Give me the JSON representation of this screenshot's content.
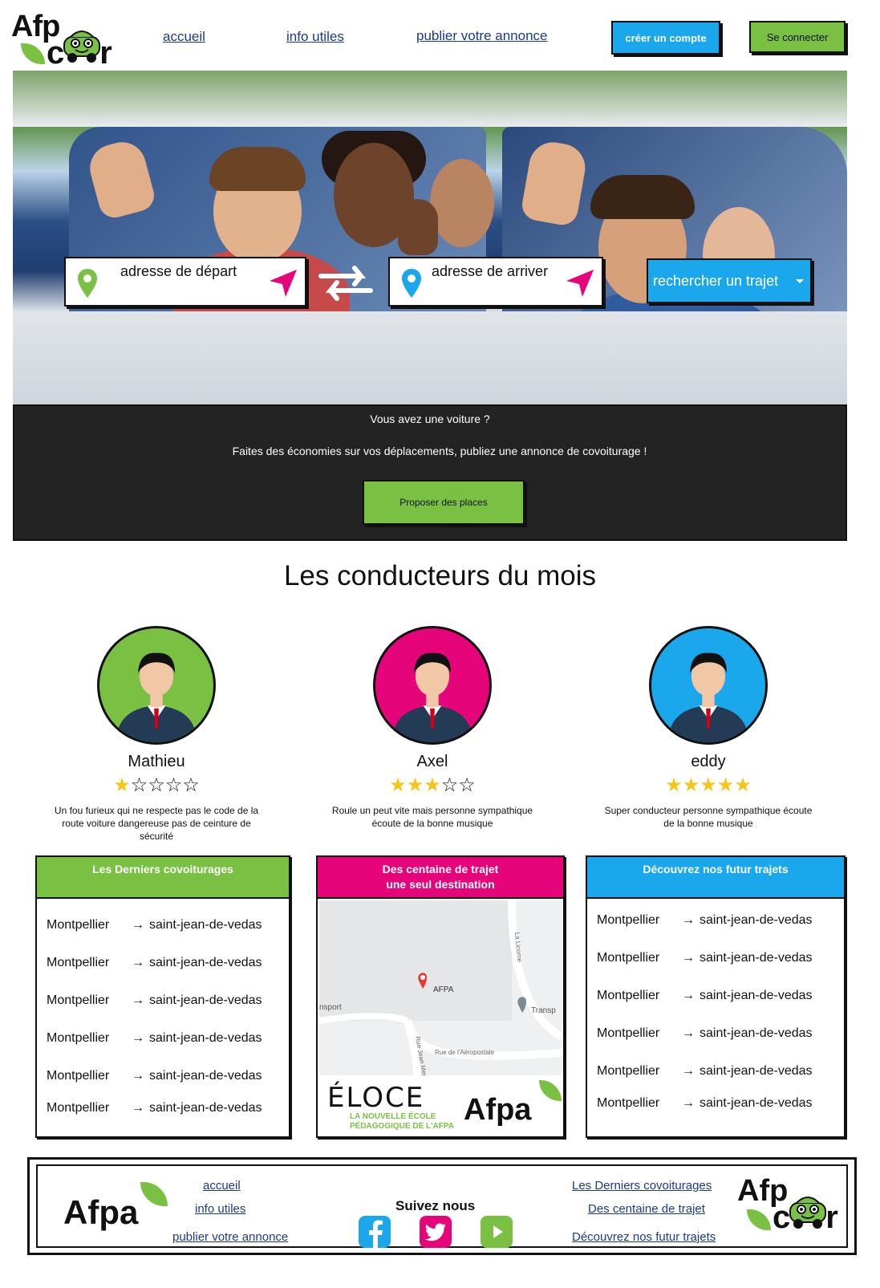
{
  "brand": {
    "logo_text_top": "Afp",
    "logo_text_bottom": "c",
    "logo_text_end": "r",
    "green": "#7ac143",
    "blue": "#1aa7ec",
    "pink": "#e5047a",
    "dark": "#232323"
  },
  "nav": {
    "home": "accueil",
    "info": "info utiles",
    "publish": "publier votre annonce",
    "create_account": "créer un compte",
    "login": "Se connecter"
  },
  "search": {
    "start_placeholder": "adresse de départ",
    "end_placeholder": "adresse de arriver",
    "button": "rechercher un trajet",
    "icons": [
      "map-pin-icon",
      "navigate-arrow-icon",
      "swap-arrows-icon",
      "dropdown-caret-icon"
    ]
  },
  "promo": {
    "question": "Vous avez une voiture ?",
    "description": "Faites des économies sur vos déplacements, publiez une annonce de covoiturage !",
    "button": "Proposer des places"
  },
  "drivers_section": {
    "title": "Les conducteurs du mois",
    "drivers": [
      {
        "name": "Mathieu",
        "rating": 1,
        "color": "#7ac143",
        "desc": "Un fou furieux qui ne respecte pas le code de la route voiture dangereuse pas de ceinture de sécurité"
      },
      {
        "name": "Axel",
        "rating": 3,
        "color": "#e5047a",
        "desc": "Roule un peut vite mais personne sympathique écoute de la bonne musique"
      },
      {
        "name": "eddy",
        "rating": 5,
        "color": "#1aa7ec",
        "desc": "Super conducteur personne sympathique écoute de la bonne musique"
      }
    ]
  },
  "cards": {
    "last": {
      "title": "Les Derniers covoiturages",
      "routes": [
        {
          "from": "Montpellier",
          "arrow": "→",
          "to": "saint-jean-de-vedas"
        },
        {
          "from": "Montpellier",
          "arrow": "→",
          "to": "saint-jean-de-vedas"
        },
        {
          "from": "Montpellier",
          "arrow": "→",
          "to": "saint-jean-de-vedas"
        },
        {
          "from": "Montpellier",
          "arrow": "→",
          "to": "saint-jean-de-vedas"
        },
        {
          "from": "Montpellier",
          "arrow": "→",
          "to": "saint-jean-de-vedas"
        },
        {
          "from": "Montpellier",
          "arrow": "→",
          "to": "saint-jean-de-vedas"
        }
      ]
    },
    "destination": {
      "title_line1": "Des centaine de trajet",
      "title_line2": "une seul destination",
      "map": {
        "marker": "AFPA",
        "place_left": "nsport",
        "place_right": "Transp",
        "street": "Rue de l'Aéropostale",
        "street2": "Rue Jean Mermoz",
        "street3": "La Licorne"
      },
      "partner_eloce": "ÉLOCE",
      "partner_eloce_sub1": "LA NOUVELLE ÉCOLE",
      "partner_eloce_sub2": "PÉDAGOGIQUE DE L'AFPA",
      "partner_afpa": "Afpa"
    },
    "future": {
      "title": "Découvrez nos futur trajets",
      "routes": [
        {
          "from": "Montpellier",
          "arrow": "→",
          "to": "saint-jean-de-vedas"
        },
        {
          "from": "Montpellier",
          "arrow": "→",
          "to": "saint-jean-de-vedas"
        },
        {
          "from": "Montpellier",
          "arrow": "→",
          "to": "saint-jean-de-vedas"
        },
        {
          "from": "Montpellier",
          "arrow": "→",
          "to": "saint-jean-de-vedas"
        },
        {
          "from": "Montpellier",
          "arrow": "→",
          "to": "saint-jean-de-vedas"
        },
        {
          "from": "Montpellier",
          "arrow": "→",
          "to": "saint-jean-de-vedas"
        }
      ]
    }
  },
  "footer": {
    "afpa": "Afpa",
    "links_left": [
      "accueil",
      "info utiles",
      "publier votre annonce"
    ],
    "follow": "Suivez nous",
    "social": [
      "facebook-icon",
      "twitter-icon",
      "youtube-icon"
    ],
    "links_right": [
      "Les Derniers covoiturages",
      "Des centaine de trajet",
      "Découvrez nos futur trajets"
    ]
  }
}
